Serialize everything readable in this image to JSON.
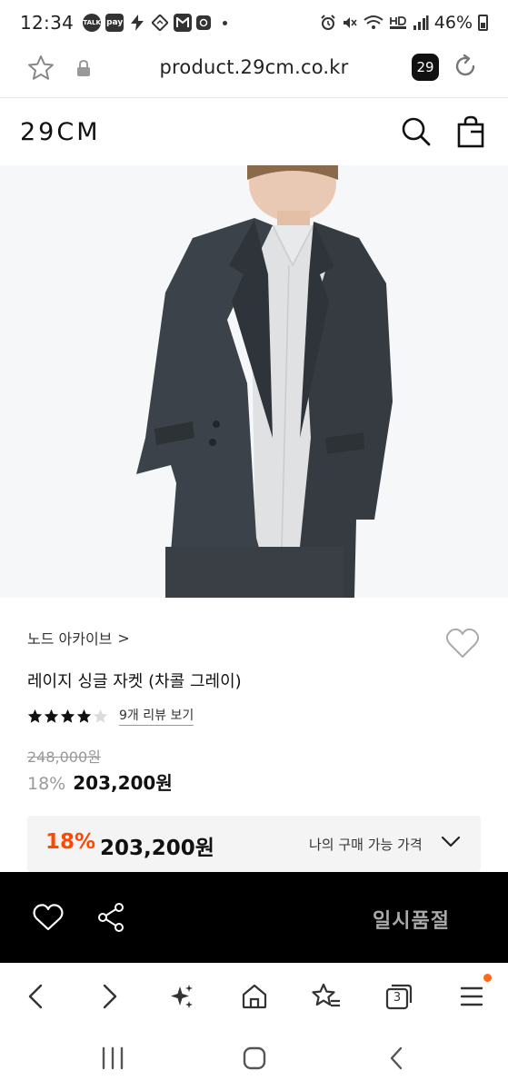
{
  "status_bar": {
    "time": "12:34",
    "left_icons": [
      "TALK",
      "pay"
    ],
    "battery": "46%"
  },
  "browser": {
    "url": "product.29cm.co.kr",
    "tab_count": "29"
  },
  "site": {
    "logo": "29CM"
  },
  "product": {
    "brand": "노드 아카이브",
    "brand_chevron": ">",
    "name": "레이지 싱글 자켓 (차콜 그레이)",
    "rating": 4,
    "rating_max": 5,
    "review_link": "9개 리뷰 보기",
    "original_price": "248,000원",
    "discount": "18%",
    "price": "203,200원"
  },
  "purchase_box": {
    "discount": "18%",
    "price": "203,200원",
    "label": "나의 구매 가능 가격"
  },
  "action_bar": {
    "soldout_label": "일시품절"
  },
  "browser_toolbar": {
    "tabs_count": "3"
  },
  "colors": {
    "accent_orange": "#ff4800",
    "action_bar_bg": "#000000",
    "muted_gray": "#999999"
  }
}
